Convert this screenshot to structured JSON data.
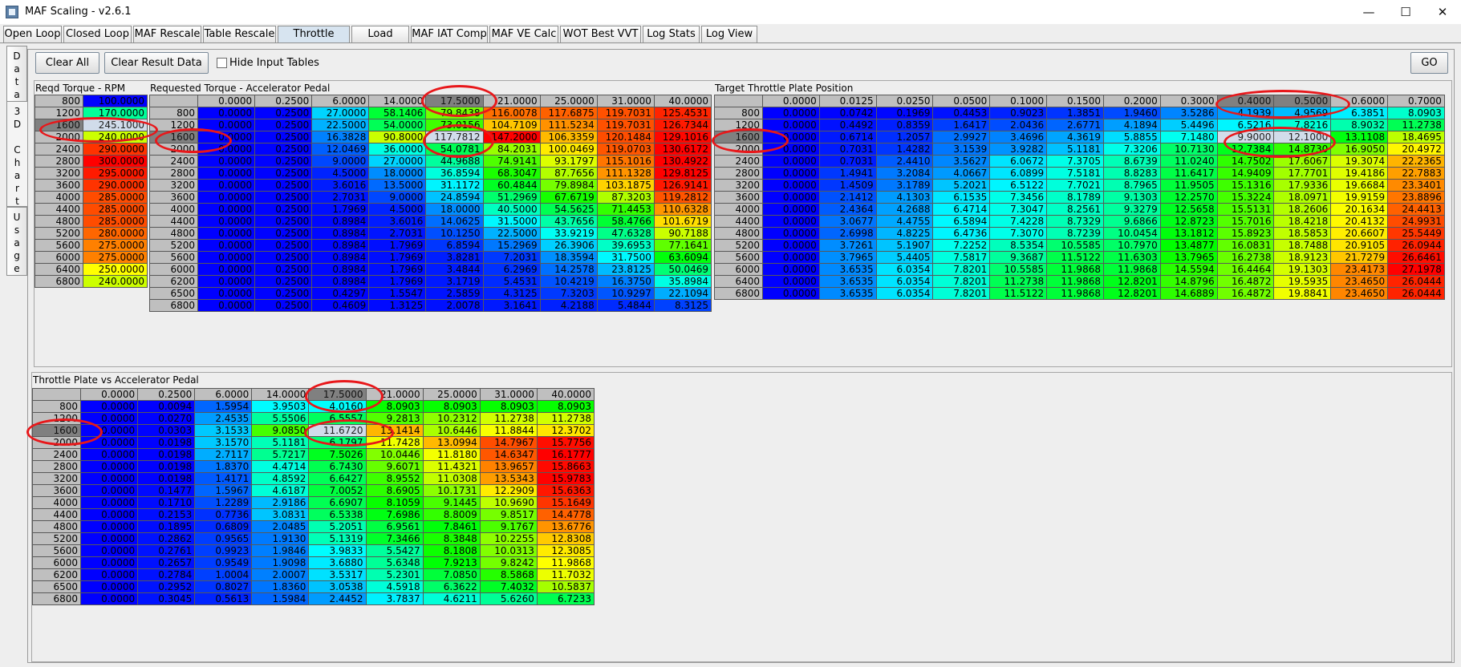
{
  "window": {
    "title": "MAF Scaling - v2.6.1",
    "minimize": "—",
    "maximize": "☐",
    "close": "✕"
  },
  "tabs": [
    {
      "label": "Open Loop",
      "w": 73
    },
    {
      "label": "Closed Loop",
      "w": 85
    },
    {
      "label": "MAF Rescale",
      "w": 85
    },
    {
      "label": "Table Rescale",
      "w": 91
    },
    {
      "label": "Throttle Maps",
      "w": 90,
      "active": true
    },
    {
      "label": "Load Comp",
      "w": 72
    },
    {
      "label": "MAF IAT Comp",
      "w": 96
    },
    {
      "label": "MAF VE Calc",
      "w": 86
    },
    {
      "label": "WOT Best VVT",
      "w": 101
    },
    {
      "label": "Log Stats",
      "w": 71
    },
    {
      "label": "Log View",
      "w": 70
    }
  ],
  "side_tabs": [
    {
      "label": "Data",
      "active": false
    },
    {
      "label": "3D Chart",
      "active": true
    },
    {
      "label": "Usage",
      "active": false
    }
  ],
  "toolbar": {
    "clear_all": "Clear All",
    "clear_result": "Clear Result Data",
    "hide_input": "Hide Input Tables",
    "go": "GO"
  },
  "colors": {
    "header": "#bfbfbf",
    "selected_header": "#808080",
    "selected_cell": "#d1dcea",
    "highlight": "#e8171a",
    "active_tab": "#d7e4f0"
  },
  "tables": {
    "reqd_rpm": {
      "title": "Reqd Torque - RPM",
      "vmin": 100,
      "vmax": 300,
      "rpm": [
        "800",
        "1200",
        "1600",
        "2000",
        "2400",
        "2800",
        "3200",
        "3600",
        "4000",
        "4400",
        "4800",
        "5200",
        "5600",
        "6000",
        "6400",
        "6800"
      ],
      "values": [
        "100.0000",
        "170.0000",
        "245.1000",
        "240.0000",
        "290.0000",
        "300.0000",
        "295.0000",
        "290.0000",
        "285.0000",
        "285.0000",
        "285.0000",
        "280.0000",
        "275.0000",
        "275.0000",
        "250.0000",
        "240.0000"
      ]
    },
    "req_torque": {
      "title": "Requested Torque - Accelerator Pedal",
      "vmin": 0,
      "vmax": 130,
      "cols": [
        "0.0000",
        "0.2500",
        "6.0000",
        "14.0000",
        "17.5000",
        "21.0000",
        "25.0000",
        "31.0000",
        "40.0000"
      ],
      "rows": [
        {
          "rpm": "800",
          "v": [
            "0.0000",
            "0.2500",
            "27.0000",
            "58.1406",
            "79.8438",
            "116.0078",
            "117.6875",
            "119.7031",
            "125.4531"
          ]
        },
        {
          "rpm": "1200",
          "v": [
            "0.0000",
            "0.2500",
            "22.5000",
            "54.0000",
            "73.0156",
            "104.7109",
            "111.5234",
            "119.7031",
            "126.7344"
          ]
        },
        {
          "rpm": "1600",
          "v": [
            "0.0000",
            "0.2500",
            "16.3828",
            "90.8000",
            "117.7812",
            "147.2000",
            "106.3359",
            "120.1484",
            "129.1016"
          ]
        },
        {
          "rpm": "2000",
          "v": [
            "0.0000",
            "0.2500",
            "12.0469",
            "36.0000",
            "54.0781",
            "84.2031",
            "100.0469",
            "119.0703",
            "130.6172"
          ]
        },
        {
          "rpm": "2400",
          "v": [
            "0.0000",
            "0.2500",
            "9.0000",
            "27.0000",
            "44.9688",
            "74.9141",
            "93.1797",
            "115.1016",
            "130.4922"
          ]
        },
        {
          "rpm": "2800",
          "v": [
            "0.0000",
            "0.2500",
            "4.5000",
            "18.0000",
            "36.8594",
            "68.3047",
            "87.7656",
            "111.1328",
            "129.8125"
          ]
        },
        {
          "rpm": "3200",
          "v": [
            "0.0000",
            "0.2500",
            "3.6016",
            "13.5000",
            "31.1172",
            "60.4844",
            "79.8984",
            "103.1875",
            "126.9141"
          ]
        },
        {
          "rpm": "3600",
          "v": [
            "0.0000",
            "0.2500",
            "2.7031",
            "9.0000",
            "24.8594",
            "51.2969",
            "67.6719",
            "87.3203",
            "119.2812"
          ]
        },
        {
          "rpm": "4000",
          "v": [
            "0.0000",
            "0.2500",
            "1.7969",
            "4.5000",
            "18.0000",
            "40.5000",
            "54.5625",
            "71.4453",
            "110.6328"
          ]
        },
        {
          "rpm": "4400",
          "v": [
            "0.0000",
            "0.2500",
            "0.8984",
            "3.6016",
            "14.0625",
            "31.5000",
            "43.7656",
            "58.4766",
            "101.6719"
          ]
        },
        {
          "rpm": "4800",
          "v": [
            "0.0000",
            "0.2500",
            "0.8984",
            "2.7031",
            "10.1250",
            "22.5000",
            "33.9219",
            "47.6328",
            "90.7188"
          ]
        },
        {
          "rpm": "5200",
          "v": [
            "0.0000",
            "0.2500",
            "0.8984",
            "1.7969",
            "6.8594",
            "15.2969",
            "26.3906",
            "39.6953",
            "77.1641"
          ]
        },
        {
          "rpm": "5600",
          "v": [
            "0.0000",
            "0.2500",
            "0.8984",
            "1.7969",
            "3.8281",
            "7.2031",
            "18.3594",
            "31.7500",
            "63.6094"
          ]
        },
        {
          "rpm": "6000",
          "v": [
            "0.0000",
            "0.2500",
            "0.8984",
            "1.7969",
            "3.4844",
            "6.2969",
            "14.2578",
            "23.8125",
            "50.0469"
          ]
        },
        {
          "rpm": "6200",
          "v": [
            "0.0000",
            "0.2500",
            "0.8984",
            "1.7969",
            "3.1719",
            "5.4531",
            "10.4219",
            "16.3750",
            "35.8984"
          ]
        },
        {
          "rpm": "6500",
          "v": [
            "0.0000",
            "0.2500",
            "0.4297",
            "1.5547",
            "2.5859",
            "4.3125",
            "7.3203",
            "10.9297",
            "22.1094"
          ]
        },
        {
          "rpm": "6800",
          "v": [
            "0.0000",
            "0.2500",
            "0.4609",
            "1.3125",
            "2.0078",
            "3.1641",
            "4.2188",
            "5.4844",
            "8.3125"
          ]
        }
      ]
    },
    "target_tp": {
      "title": "Target Throttle Plate Position",
      "vmin": 0,
      "vmax": 27,
      "cols": [
        "0.0000",
        "0.0125",
        "0.0250",
        "0.0500",
        "0.1000",
        "0.1500",
        "0.2000",
        "0.3000",
        "0.4000",
        "0.5000",
        "0.6000",
        "0.7000"
      ],
      "rows": [
        {
          "rpm": "800",
          "v": [
            "0.0000",
            "0.0742",
            "0.1969",
            "0.4453",
            "0.9023",
            "1.3851",
            "1.9460",
            "3.5286",
            "4.1939",
            "4.9569",
            "6.3851",
            "8.0903"
          ]
        },
        {
          "rpm": "1200",
          "v": [
            "0.0000",
            "0.4492",
            "0.8359",
            "1.6417",
            "2.0436",
            "2.6771",
            "4.1894",
            "5.4496",
            "6.5216",
            "7.8216",
            "8.9032",
            "11.2738"
          ]
        },
        {
          "rpm": "1600",
          "v": [
            "0.0000",
            "0.6714",
            "1.2057",
            "2.9927",
            "3.4696",
            "4.3619",
            "5.8855",
            "7.1480",
            "9.9000",
            "12.1000",
            "13.1108",
            "18.4695"
          ]
        },
        {
          "rpm": "2000",
          "v": [
            "0.0000",
            "0.7031",
            "1.4282",
            "3.1539",
            "3.9282",
            "5.1181",
            "7.3206",
            "10.7130",
            "12.7384",
            "14.8730",
            "16.9050",
            "20.4972"
          ]
        },
        {
          "rpm": "2400",
          "v": [
            "0.0000",
            "0.7031",
            "2.4410",
            "3.5627",
            "6.0672",
            "7.3705",
            "8.6739",
            "11.0240",
            "14.7502",
            "17.6067",
            "19.3074",
            "22.2365"
          ]
        },
        {
          "rpm": "2800",
          "v": [
            "0.0000",
            "1.4941",
            "3.2084",
            "4.0667",
            "6.0899",
            "7.5181",
            "8.8283",
            "11.6417",
            "14.9409",
            "17.7701",
            "19.4186",
            "22.7883"
          ]
        },
        {
          "rpm": "3200",
          "v": [
            "0.0000",
            "1.4509",
            "3.1789",
            "5.2021",
            "6.5122",
            "7.7021",
            "8.7965",
            "11.9505",
            "15.1316",
            "17.9336",
            "19.6684",
            "23.3401"
          ]
        },
        {
          "rpm": "3600",
          "v": [
            "0.0000",
            "2.1412",
            "4.1303",
            "6.1535",
            "7.3456",
            "8.1789",
            "9.1303",
            "12.2570",
            "15.3224",
            "18.0971",
            "19.9159",
            "23.8896"
          ]
        },
        {
          "rpm": "4000",
          "v": [
            "0.0000",
            "2.4364",
            "4.2688",
            "6.4714",
            "7.3047",
            "8.2561",
            "9.3279",
            "12.5658",
            "15.5131",
            "18.2606",
            "20.1634",
            "24.4413"
          ]
        },
        {
          "rpm": "4400",
          "v": [
            "0.0000",
            "3.0677",
            "4.4755",
            "6.5894",
            "7.4228",
            "8.7329",
            "9.6866",
            "12.8723",
            "15.7016",
            "18.4218",
            "20.4132",
            "24.9931"
          ]
        },
        {
          "rpm": "4800",
          "v": [
            "0.0000",
            "2.6998",
            "4.8225",
            "6.4736",
            "7.3070",
            "8.7239",
            "10.0454",
            "13.1812",
            "15.8923",
            "18.5853",
            "20.6607",
            "25.5449"
          ]
        },
        {
          "rpm": "5200",
          "v": [
            "0.0000",
            "3.7261",
            "5.1907",
            "7.2252",
            "8.5354",
            "10.5585",
            "10.7970",
            "13.4877",
            "16.0831",
            "18.7488",
            "20.9105",
            "26.0944"
          ]
        },
        {
          "rpm": "5600",
          "v": [
            "0.0000",
            "3.7965",
            "5.4405",
            "7.5817",
            "9.3687",
            "11.5122",
            "11.6303",
            "13.7965",
            "16.2738",
            "18.9123",
            "21.7279",
            "26.6461"
          ]
        },
        {
          "rpm": "6000",
          "v": [
            "0.0000",
            "3.6535",
            "6.0354",
            "7.8201",
            "10.5585",
            "11.9868",
            "11.9868",
            "14.5594",
            "16.4464",
            "19.1303",
            "23.4173",
            "27.1978"
          ]
        },
        {
          "rpm": "6400",
          "v": [
            "0.0000",
            "3.6535",
            "6.0354",
            "7.8201",
            "11.2738",
            "11.9868",
            "12.8201",
            "14.8796",
            "16.4872",
            "19.5935",
            "23.4650",
            "26.0444"
          ]
        },
        {
          "rpm": "6800",
          "v": [
            "0.0000",
            "3.6535",
            "6.0354",
            "7.8201",
            "11.5122",
            "11.9868",
            "12.8201",
            "14.6889",
            "16.4872",
            "19.8841",
            "23.4650",
            "26.0444"
          ]
        }
      ]
    },
    "tp_vs_pedal": {
      "title": "Throttle Plate vs Accelerator Pedal",
      "vmin": 0,
      "vmax": 16,
      "cols": [
        "0.0000",
        "0.2500",
        "6.0000",
        "14.0000",
        "17.5000",
        "21.0000",
        "25.0000",
        "31.0000",
        "40.0000"
      ],
      "rows": [
        {
          "rpm": "800",
          "v": [
            "0.0000",
            "0.0094",
            "1.5954",
            "3.9503",
            "4.0160",
            "8.0903",
            "8.0903",
            "8.0903",
            "8.0903"
          ]
        },
        {
          "rpm": "1200",
          "v": [
            "0.0000",
            "0.0270",
            "2.4535",
            "5.5506",
            "6.5557",
            "9.2813",
            "10.2312",
            "11.2738",
            "11.2738"
          ]
        },
        {
          "rpm": "1600",
          "v": [
            "0.0000",
            "0.0303",
            "3.1533",
            "9.0850",
            "11.6720",
            "13.1414",
            "10.6446",
            "11.8844",
            "12.3702"
          ]
        },
        {
          "rpm": "2000",
          "v": [
            "0.0000",
            "0.0198",
            "3.1570",
            "5.1181",
            "6.1797",
            "11.7428",
            "13.0994",
            "14.7967",
            "15.7756"
          ]
        },
        {
          "rpm": "2400",
          "v": [
            "0.0000",
            "0.0198",
            "2.7117",
            "5.7217",
            "7.5026",
            "10.0446",
            "11.8180",
            "14.6347",
            "16.1777"
          ]
        },
        {
          "rpm": "2800",
          "v": [
            "0.0000",
            "0.0198",
            "1.8370",
            "4.4714",
            "6.7430",
            "9.6071",
            "11.4321",
            "13.9657",
            "15.8663"
          ]
        },
        {
          "rpm": "3200",
          "v": [
            "0.0000",
            "0.0198",
            "1.4171",
            "4.8592",
            "6.6427",
            "8.9552",
            "11.0308",
            "13.5343",
            "15.9783"
          ]
        },
        {
          "rpm": "3600",
          "v": [
            "0.0000",
            "0.1477",
            "1.5967",
            "4.6187",
            "7.0052",
            "8.6905",
            "10.1731",
            "12.2909",
            "15.6363"
          ]
        },
        {
          "rpm": "4000",
          "v": [
            "0.0000",
            "0.1710",
            "1.2289",
            "2.9186",
            "6.6907",
            "8.1059",
            "9.1445",
            "10.9690",
            "15.1649"
          ]
        },
        {
          "rpm": "4400",
          "v": [
            "0.0000",
            "0.2153",
            "0.7736",
            "3.0831",
            "6.5338",
            "7.6986",
            "8.8009",
            "9.8517",
            "14.4778"
          ]
        },
        {
          "rpm": "4800",
          "v": [
            "0.0000",
            "0.1895",
            "0.6809",
            "2.0485",
            "5.2051",
            "6.9561",
            "7.8461",
            "9.1767",
            "13.6776"
          ]
        },
        {
          "rpm": "5200",
          "v": [
            "0.0000",
            "0.2862",
            "0.9565",
            "1.9130",
            "5.1319",
            "7.3466",
            "8.3848",
            "10.2255",
            "12.8308"
          ]
        },
        {
          "rpm": "5600",
          "v": [
            "0.0000",
            "0.2761",
            "0.9923",
            "1.9846",
            "3.9833",
            "5.5427",
            "8.1808",
            "10.0313",
            "12.3085"
          ]
        },
        {
          "rpm": "6000",
          "v": [
            "0.0000",
            "0.2657",
            "0.9549",
            "1.9098",
            "3.6880",
            "5.6348",
            "7.9213",
            "9.8242",
            "11.9868"
          ]
        },
        {
          "rpm": "6200",
          "v": [
            "0.0000",
            "0.2784",
            "1.0004",
            "2.0007",
            "3.5317",
            "5.2301",
            "7.0850",
            "8.5868",
            "11.7032"
          ]
        },
        {
          "rpm": "6500",
          "v": [
            "0.0000",
            "0.2952",
            "0.8027",
            "1.8360",
            "3.0538",
            "4.5918",
            "6.3622",
            "7.4032",
            "10.5837"
          ]
        },
        {
          "rpm": "6800",
          "v": [
            "0.0000",
            "0.3045",
            "0.5613",
            "1.5984",
            "2.4452",
            "3.7837",
            "4.6211",
            "5.6260",
            "6.7233"
          ]
        }
      ]
    }
  }
}
